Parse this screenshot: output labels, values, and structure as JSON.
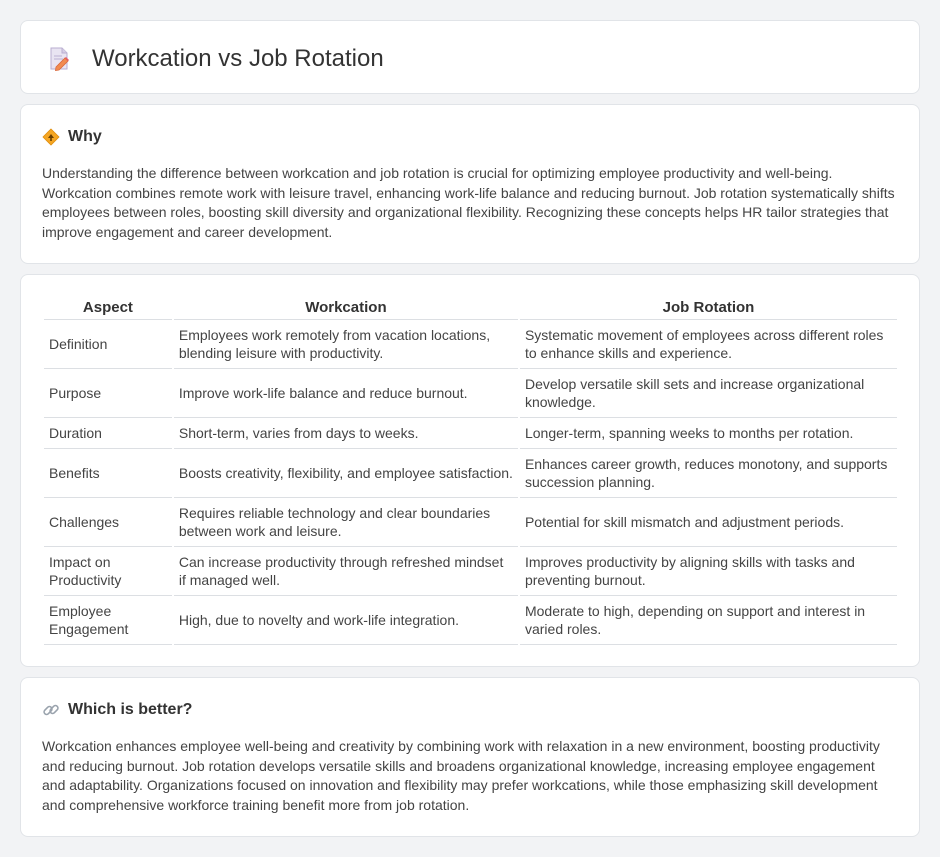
{
  "header": {
    "title": "Workcation vs Job Rotation",
    "icon": "document-pencil-icon"
  },
  "why": {
    "heading": "Why",
    "icon": "diamond-direction-icon",
    "text": "Understanding the difference between workcation and job rotation is crucial for optimizing employee productivity and well-being. Workcation combines remote work with leisure travel, enhancing work-life balance and reducing burnout. Job rotation systematically shifts employees between roles, boosting skill diversity and organizational flexibility. Recognizing these concepts helps HR tailor strategies that improve engagement and career development."
  },
  "table": {
    "columns": [
      "Aspect",
      "Workcation",
      "Job Rotation"
    ],
    "rows": [
      {
        "aspect": "Definition",
        "workcation": "Employees work remotely from vacation locations, blending leisure with productivity.",
        "job_rotation": "Systematic movement of employees across different roles to enhance skills and experience."
      },
      {
        "aspect": "Purpose",
        "workcation": "Improve work-life balance and reduce burnout.",
        "job_rotation": "Develop versatile skill sets and increase organizational knowledge."
      },
      {
        "aspect": "Duration",
        "workcation": "Short-term, varies from days to weeks.",
        "job_rotation": "Longer-term, spanning weeks to months per rotation."
      },
      {
        "aspect": "Benefits",
        "workcation": "Boosts creativity, flexibility, and employee satisfaction.",
        "job_rotation": "Enhances career growth, reduces monotony, and supports succession planning."
      },
      {
        "aspect": "Challenges",
        "workcation": "Requires reliable technology and clear boundaries between work and leisure.",
        "job_rotation": "Potential for skill mismatch and adjustment periods."
      },
      {
        "aspect": "Impact on Productivity",
        "workcation": "Can increase productivity through refreshed mindset if managed well.",
        "job_rotation": "Improves productivity by aligning skills with tasks and preventing burnout."
      },
      {
        "aspect": "Employee Engagement",
        "workcation": "High, due to novelty and work-life integration.",
        "job_rotation": "Moderate to high, depending on support and interest in varied roles."
      }
    ]
  },
  "better": {
    "heading": "Which is better?",
    "icon": "link-icon",
    "text": "Workcation enhances employee well-being and creativity by combining work with relaxation in a new environment, boosting productivity and reducing burnout. Job rotation develops versatile skills and broadens organizational knowledge, increasing employee engagement and adaptability. Organizations focused on innovation and flexibility may prefer workcations, while those emphasizing skill development and comprehensive workforce training benefit more from job rotation."
  },
  "colors": {
    "background": "#f2f3f5",
    "card": "#ffffff",
    "border": "#e1e4e8",
    "accent_orange": "#f5a623"
  }
}
